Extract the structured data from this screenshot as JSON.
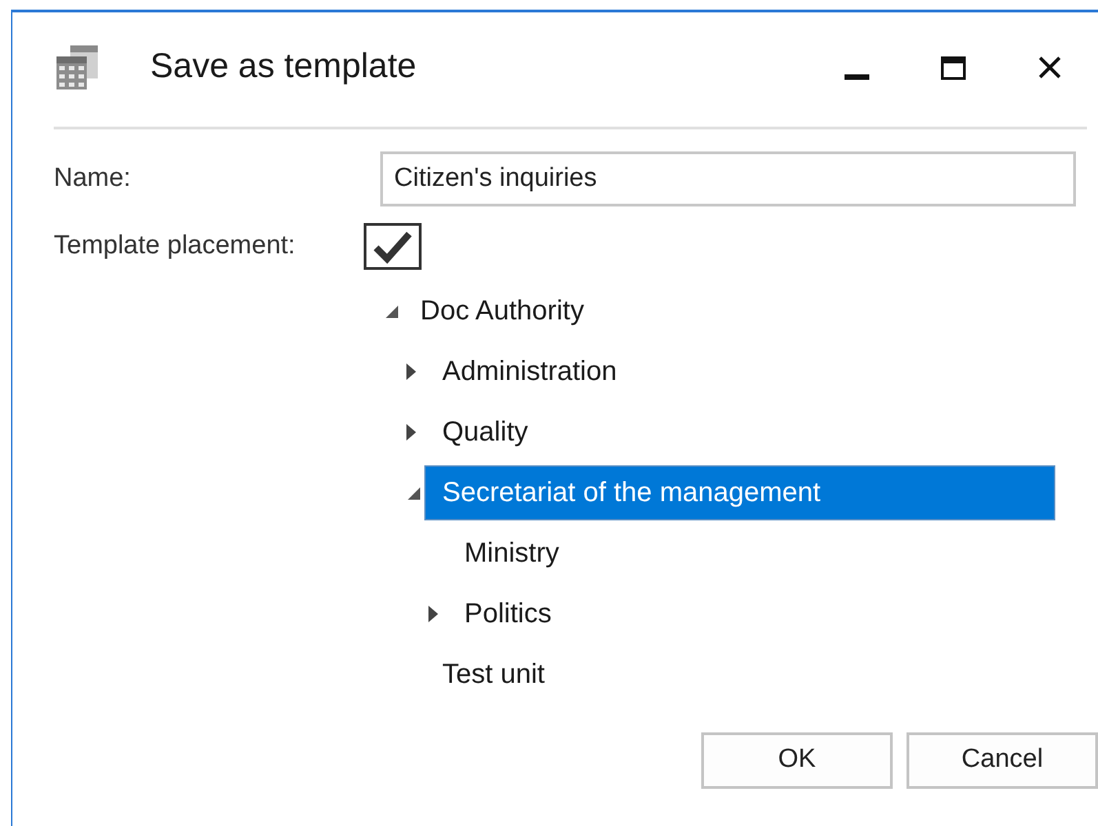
{
  "window": {
    "title": "Save as template"
  },
  "form": {
    "name_label": "Name:",
    "name_value": "Citizen's inquiries",
    "placement_label": "Template placement:",
    "placement_checked": true
  },
  "tree": [
    {
      "label": "Doc Authority",
      "expanded": true,
      "selected": false,
      "children": [
        {
          "label": "Administration",
          "expanded": false,
          "selected": false
        },
        {
          "label": "Quality",
          "expanded": false,
          "selected": false
        },
        {
          "label": "Secretariat of the management",
          "expanded": true,
          "selected": true,
          "children": [
            {
              "label": "Ministry",
              "selected": false
            },
            {
              "label": "Politics",
              "expanded": false,
              "selected": false
            }
          ]
        },
        {
          "label": "Test unit",
          "selected": false
        }
      ]
    }
  ],
  "buttons": [
    "OK",
    "Cancel"
  ]
}
